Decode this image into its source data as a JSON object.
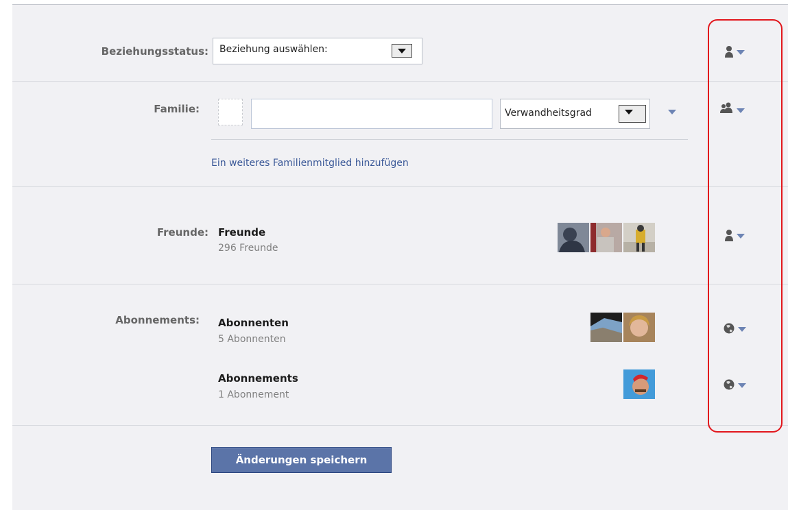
{
  "relationship": {
    "label": "Beziehungsstatus:",
    "select_value": "Beziehung auswählen:",
    "privacy_icon": "person-icon"
  },
  "family": {
    "label": "Familie:",
    "input_value": "",
    "degree_select_value": "Verwandheitsgrad",
    "add_link": "Ein weiteres Familienmitglied hinzufügen",
    "privacy_icon": "people-icon"
  },
  "friends": {
    "label": "Freunde:",
    "title": "Freunde",
    "count": "296 Freunde",
    "privacy_icon": "person-icon"
  },
  "subscriptions": {
    "label": "Abonnements:",
    "subscribers_title": "Abonnenten",
    "subscribers_count": "5 Abonnenten",
    "subscriptions_title": "Abonnements",
    "subscriptions_count": "1 Abonnement",
    "privacy_icon": "globe-icon"
  },
  "save_button": "Änderungen speichern",
  "colors": {
    "link": "#3b5998",
    "button": "#5b74a8",
    "highlight_box": "#e2161c"
  }
}
